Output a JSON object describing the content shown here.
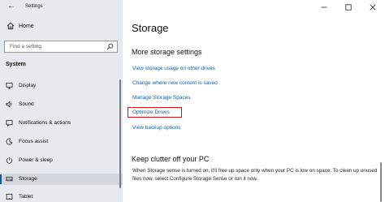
{
  "window": {
    "back_glyph": "←",
    "title": "Settings",
    "controls": {
      "minimize": "—",
      "maximize": "☐",
      "close": "✕"
    }
  },
  "sidebar": {
    "home_label": "Home",
    "search": {
      "placeholder": "Find a setting",
      "value": ""
    },
    "section_label": "System",
    "items": [
      {
        "label": "Display",
        "icon": "display-icon",
        "selected": false
      },
      {
        "label": "Sound",
        "icon": "sound-icon",
        "selected": false
      },
      {
        "label": "Notifications & actions",
        "icon": "notifications-icon",
        "selected": false
      },
      {
        "label": "Focus assist",
        "icon": "focus-assist-icon",
        "selected": false
      },
      {
        "label": "Power & sleep",
        "icon": "power-icon",
        "selected": false
      },
      {
        "label": "Storage",
        "icon": "storage-icon",
        "selected": true
      },
      {
        "label": "Tablet",
        "icon": "tablet-icon",
        "selected": false
      }
    ]
  },
  "main": {
    "title": "Storage",
    "more_settings": {
      "heading": "More storage settings",
      "links": [
        {
          "label": "View storage usage on other drives"
        },
        {
          "label": "Change where new content is saved"
        },
        {
          "label": "Manage Storage Spaces"
        },
        {
          "label": "Optimize Drives",
          "highlighted": true
        },
        {
          "label": "View backup options"
        }
      ]
    },
    "clutter": {
      "heading": "Keep clutter off your PC",
      "text": "When Storage sense is turned on, it'll free up space only when your PC is low on space. To clean up unused files now, select Configure Storage Sense or run it now."
    }
  },
  "colors": {
    "accent": "#0063b1",
    "link": "#0a5fb4",
    "highlight": "#d0101a",
    "sidebar_bg": "#e6eaef"
  }
}
